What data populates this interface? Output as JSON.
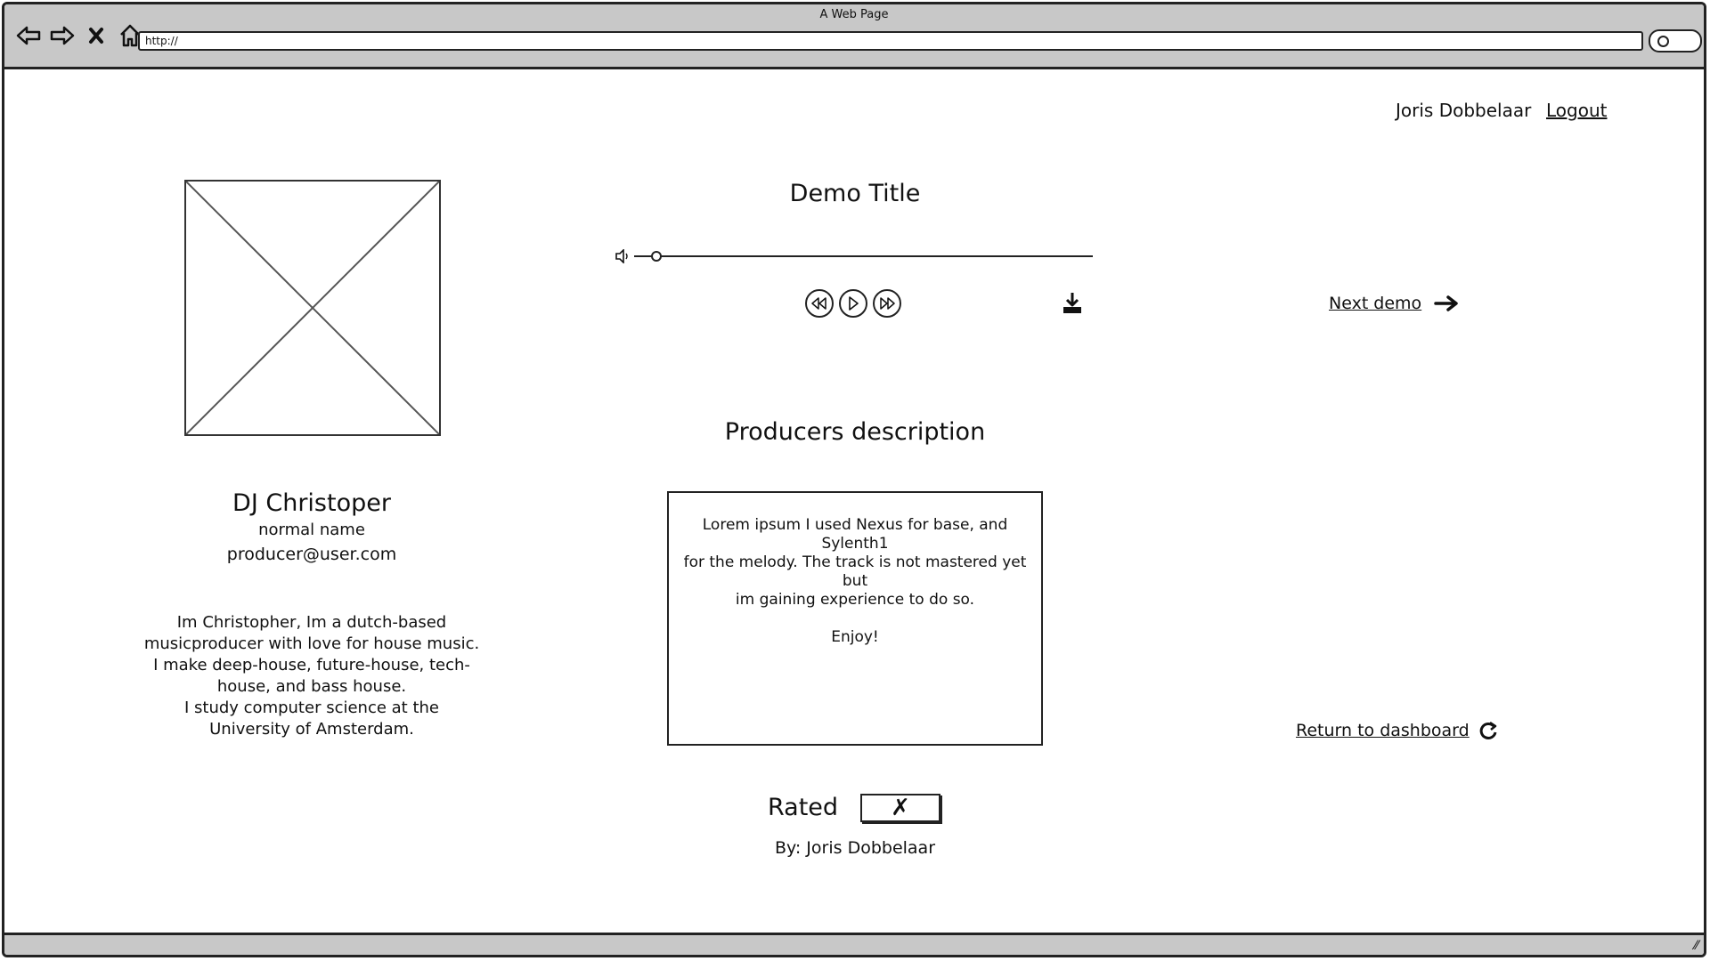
{
  "browser": {
    "window_title": "A Web Page",
    "url": "http://"
  },
  "header": {
    "user_name": "Joris Dobbelaar",
    "logout_label": "Logout"
  },
  "producer": {
    "dj_name": "DJ Christoper",
    "real_name": "normal name",
    "email": "producer@user.com",
    "bio_lines": [
      "Im Christopher, Im a dutch-based",
      "musicproducer with love for house music.",
      "I make deep-house, future-house, tech-",
      "house, and bass house.",
      "I study computer science at the",
      "University of Amsterdam."
    ]
  },
  "player": {
    "demo_title": "Demo Title",
    "volume_icon": "speaker-icon",
    "controls": [
      "rewind-icon",
      "play-icon",
      "fast-forward-icon"
    ],
    "download_icon": "download-icon"
  },
  "navigation": {
    "next_demo_label": "Next demo",
    "return_label": "Return to dashboard"
  },
  "description": {
    "heading": "Producers description",
    "lines": [
      "Lorem ipsum I used Nexus for base, and Sylenth1",
      "for the melody. The track is not mastered yet but",
      "im gaining experience to do so."
    ],
    "closing": "Enjoy!"
  },
  "rating": {
    "label": "Rated",
    "value_symbol": "✗",
    "by": "By: Joris Dobbelaar"
  }
}
